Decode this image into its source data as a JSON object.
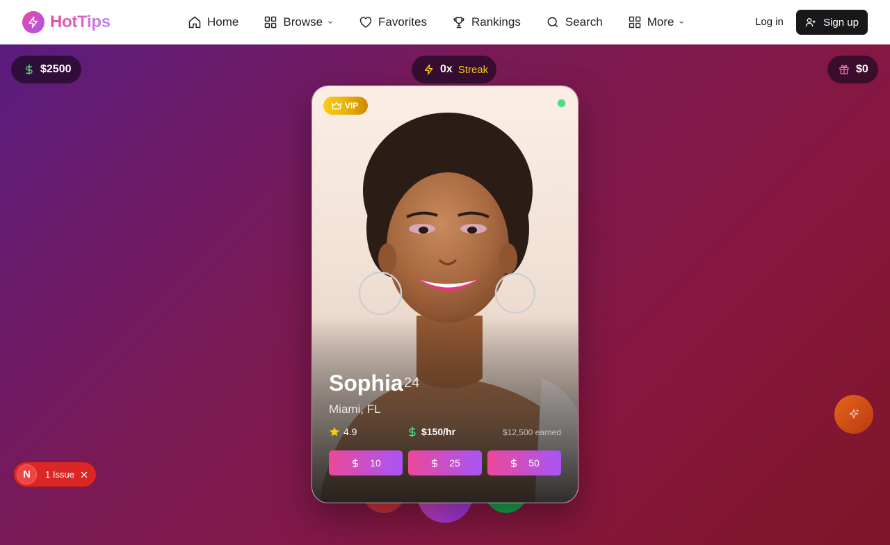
{
  "brand": {
    "name": "HotTips",
    "logo_icon": "lightning-bolt-icon",
    "gradient": [
      "#ec4899",
      "#a855f7"
    ]
  },
  "nav": {
    "items": [
      {
        "label": "Home",
        "icon": "home-icon"
      },
      {
        "label": "Browse",
        "icon": "grid-icon",
        "dropdown": true
      },
      {
        "label": "Favorites",
        "icon": "heart-icon"
      },
      {
        "label": "Rankings",
        "icon": "trophy-icon"
      },
      {
        "label": "Search",
        "icon": "search-icon"
      },
      {
        "label": "More",
        "icon": "grid-icon",
        "dropdown": true
      }
    ],
    "login_label": "Log in",
    "signup_label": "Sign up"
  },
  "stats": {
    "balance": "$2500",
    "streak_value": "0x",
    "streak_label": "Streak",
    "gift_value": "$0"
  },
  "profile": {
    "badge": "VIP",
    "online": true,
    "name": "Sophia",
    "age": "24",
    "location": "Miami, FL",
    "rating": "4.9",
    "rate": "$150/hr",
    "earned": "$12,500 earned",
    "tip_amounts": [
      "10",
      "25",
      "50"
    ]
  },
  "dev_overlay": {
    "letter": "N",
    "issues_label": "1 Issue"
  },
  "colors": {
    "accent_pink": "#ec4899",
    "accent_purple": "#a855f7",
    "success_green": "#4ade80",
    "streak_yellow": "#facc15",
    "vip_gold": "#eab308",
    "issue_red": "#dc2626"
  }
}
